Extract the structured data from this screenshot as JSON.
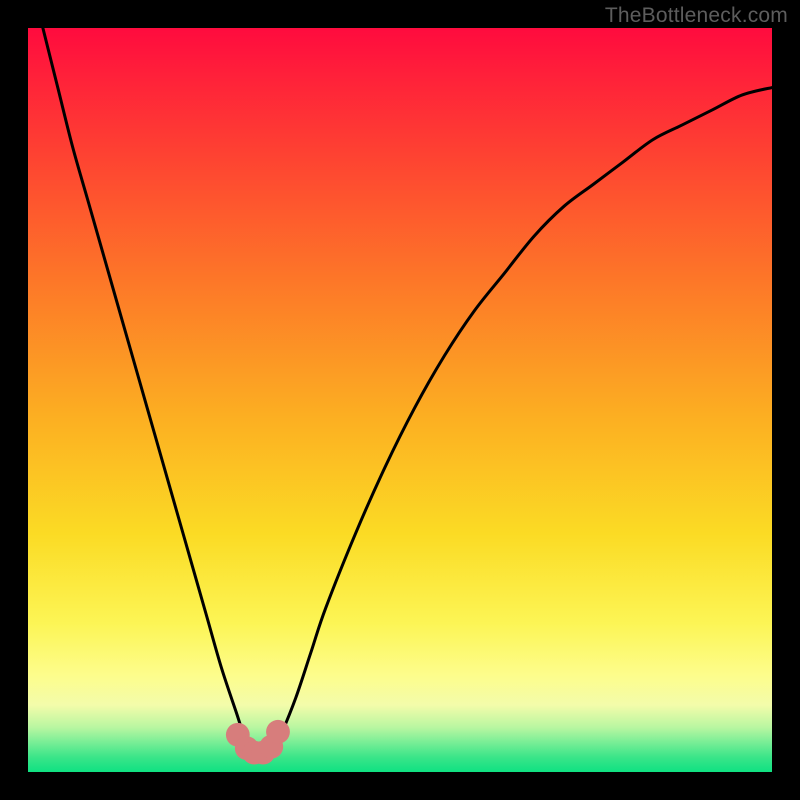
{
  "watermark": "TheBottleneck.com",
  "chart_data": {
    "type": "line",
    "title": "",
    "xlabel": "",
    "ylabel": "",
    "xlim": [
      0,
      100
    ],
    "ylim": [
      0,
      100
    ],
    "grid": false,
    "legend": false,
    "series": [
      {
        "name": "bottleneck-curve",
        "x": [
          2,
          4,
          6,
          8,
          10,
          12,
          14,
          16,
          18,
          20,
          22,
          24,
          26,
          28,
          29,
          30,
          31,
          32,
          33,
          34,
          36,
          38,
          40,
          44,
          48,
          52,
          56,
          60,
          64,
          68,
          72,
          76,
          80,
          84,
          88,
          92,
          96,
          100
        ],
        "y": [
          100,
          92,
          84,
          77,
          70,
          63,
          56,
          49,
          42,
          35,
          28,
          21,
          14,
          8,
          5,
          3,
          2.5,
          2.5,
          3,
          5,
          10,
          16,
          22,
          32,
          41,
          49,
          56,
          62,
          67,
          72,
          76,
          79,
          82,
          85,
          87,
          89,
          91,
          92
        ]
      }
    ],
    "background_gradient": {
      "orientation": "vertical",
      "stops": [
        {
          "pos": 0.0,
          "color": "#ff0b3e"
        },
        {
          "pos": 0.18,
          "color": "#fe4531"
        },
        {
          "pos": 0.52,
          "color": "#fcae22"
        },
        {
          "pos": 0.8,
          "color": "#fcf555"
        },
        {
          "pos": 0.94,
          "color": "#b9f6a1"
        },
        {
          "pos": 1.0,
          "color": "#0fe182"
        }
      ]
    },
    "markers": [
      {
        "name": "dip-left-edge",
        "x": 28.2,
        "y": 5.0,
        "color": "#d77d7c",
        "r": 1.6
      },
      {
        "name": "dip-left-mid",
        "x": 29.4,
        "y": 3.2,
        "color": "#d77d7c",
        "r": 1.6
      },
      {
        "name": "dip-bottom-1",
        "x": 30.4,
        "y": 2.6,
        "color": "#d77d7c",
        "r": 1.6
      },
      {
        "name": "dip-bottom-2",
        "x": 31.6,
        "y": 2.6,
        "color": "#d77d7c",
        "r": 1.6
      },
      {
        "name": "dip-right-mid",
        "x": 32.7,
        "y": 3.4,
        "color": "#d77d7c",
        "r": 1.6
      },
      {
        "name": "dip-right-edge",
        "x": 33.6,
        "y": 5.4,
        "color": "#d77d7c",
        "r": 1.6
      }
    ],
    "colors": {
      "curve": "#000000",
      "marker": "#d77d7c",
      "frame": "#000000"
    }
  }
}
